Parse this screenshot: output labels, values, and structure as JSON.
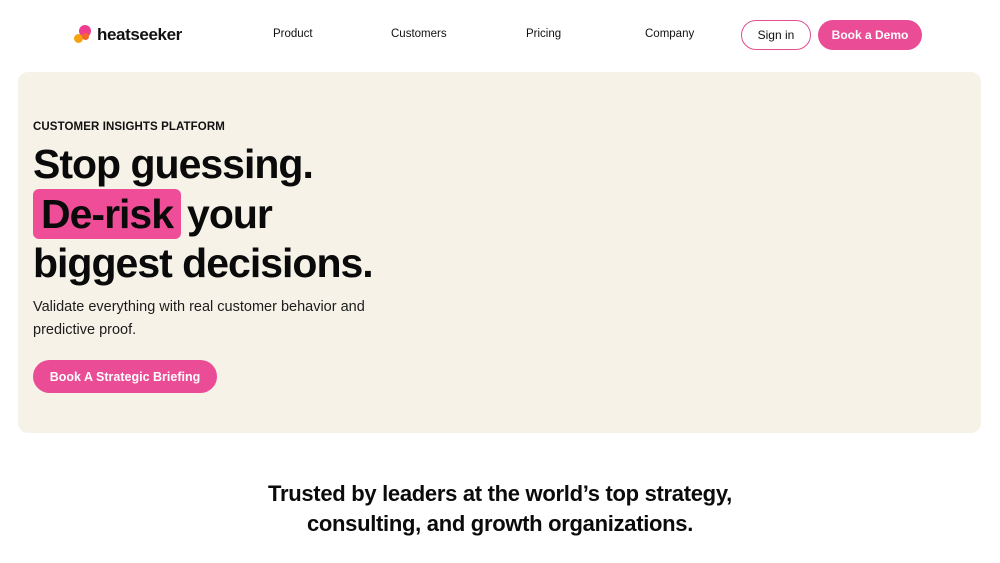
{
  "brand": {
    "name": "heatseeker"
  },
  "nav": {
    "items": [
      "Product",
      "Customers",
      "Pricing",
      "Company"
    ],
    "signin_label": "Sign in",
    "demo_label": "Book a Demo"
  },
  "hero": {
    "eyebrow": "CUSTOMER INSIGHTS PLATFORM",
    "headline_line1": "Stop guessing.",
    "headline_highlight": "De-risk",
    "headline_line2_rest": "your",
    "headline_line3": "biggest decisions.",
    "subtext": "Validate everything with real customer behavior and predictive proof.",
    "cta_label": "Book A Strategic Briefing"
  },
  "trusted": {
    "line1": "Trusted by leaders at the world’s top strategy,",
    "line2": "consulting, and growth organizations."
  },
  "colors": {
    "accent_pink": "#ea4c96",
    "hero_bg": "#f6f2e8",
    "logo_orange": "#f5a40f"
  }
}
